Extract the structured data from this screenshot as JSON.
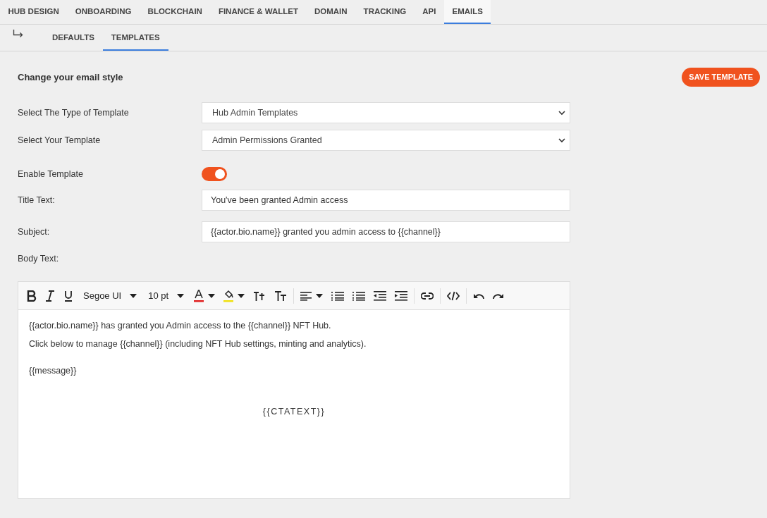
{
  "tabs": [
    {
      "label": "HUB DESIGN",
      "selected": false
    },
    {
      "label": "ONBOARDING",
      "selected": false
    },
    {
      "label": "BLOCKCHAIN",
      "selected": false
    },
    {
      "label": "FINANCE & WALLET",
      "selected": false
    },
    {
      "label": "DOMAIN",
      "selected": false
    },
    {
      "label": "TRACKING",
      "selected": false
    },
    {
      "label": "API",
      "selected": false
    },
    {
      "label": "EMAILS",
      "selected": true
    }
  ],
  "subtabs": [
    {
      "label": "DEFAULTS",
      "selected": false
    },
    {
      "label": "TEMPLATES",
      "selected": true
    }
  ],
  "heading": "Change your email style",
  "save_button": "SAVE TEMPLATE",
  "fields": [
    {
      "kind": "select",
      "label": "Select The Type of Template",
      "value": "Hub Admin Templates"
    },
    {
      "kind": "select",
      "label": "Select Your Template",
      "value": "Admin Permissions Granted"
    },
    {
      "kind": "toggle",
      "label": "Enable Template",
      "on": true
    },
    {
      "kind": "text",
      "label": "Title Text:",
      "value": "You've been granted Admin access"
    },
    {
      "kind": "text",
      "label": "Subject:",
      "value": "{{actor.bio.name}} granted you admin access to {{channel}}"
    },
    {
      "kind": "heading",
      "label": "Body Text:"
    }
  ],
  "editor": {
    "font": "Segoe UI",
    "size": "10 pt",
    "body": [
      {
        "kind": "line",
        "text": "{{actor.bio.name}} has granted you Admin access to the {{channel}} NFT Hub."
      },
      {
        "kind": "line",
        "text": "Click below to manage {{channel}} (including NFT Hub settings, minting and analytics)."
      },
      {
        "kind": "gap",
        "text": "{{message}}"
      },
      {
        "kind": "cta",
        "text": "{{CTATEXT}}"
      }
    ]
  }
}
